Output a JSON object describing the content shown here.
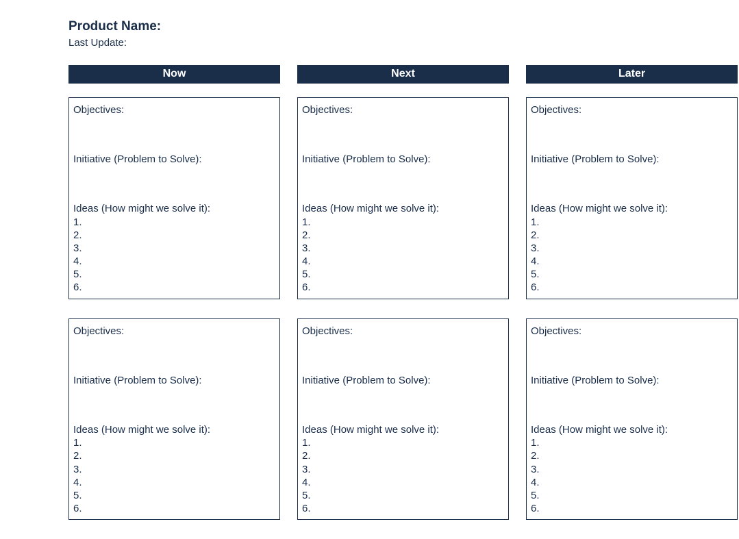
{
  "header": {
    "product_name": "Product Name:",
    "last_update": "Last Update:"
  },
  "columns": [
    {
      "title": "Now"
    },
    {
      "title": "Next"
    },
    {
      "title": "Later"
    }
  ],
  "card_labels": {
    "objectives": "Objectives:",
    "initiative": "Initiative (Problem to Solve):",
    "ideas": "Ideas (How might we solve it):"
  },
  "ideas_list": [
    "1.",
    "2.",
    "3.",
    "4.",
    "5.",
    "6."
  ]
}
